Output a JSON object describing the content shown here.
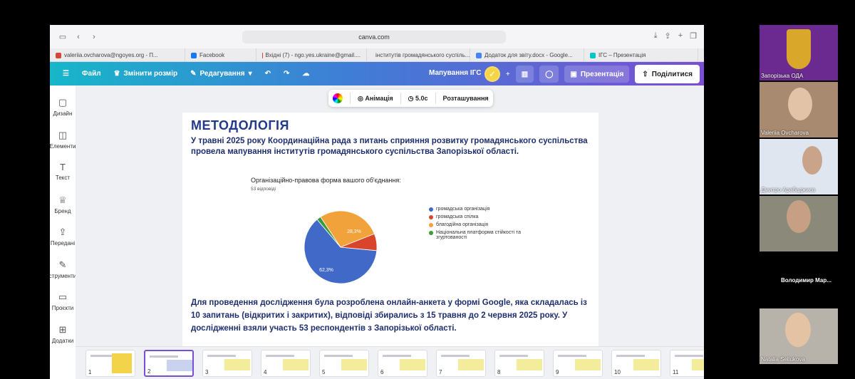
{
  "browser": {
    "url": "canva.com",
    "tabs": [
      {
        "label": "valeriia.ovcharova@ngoyes.org - П...",
        "color": "#d44638"
      },
      {
        "label": "Facebook",
        "color": "#1877f2"
      },
      {
        "label": "Вхідні (7) - ngo.yes.ukraine@gmail....",
        "color": "#d44638"
      },
      {
        "label": "інститутів громадянського суспіль...",
        "color": "#4285f4"
      },
      {
        "label": "Додаток для звіту.docx - Google...",
        "color": "#4285f4"
      },
      {
        "label": "ІГС – Презентація",
        "color": "#00c4cc"
      }
    ]
  },
  "canva": {
    "file_label": "Файл",
    "resize_label": "Змінити розмір",
    "edit_label": "Редагування",
    "doc_title": "Мапування ІГС",
    "present_label": "Презентація",
    "share_label": "Поділитися",
    "sidebar": [
      "Дизайн",
      "Елементи",
      "Текст",
      "Бренд",
      "Передані",
      "струменти",
      "Проєкти",
      "Додатки"
    ],
    "float_bar": {
      "animation": "Анімація",
      "duration": "5.0с",
      "position": "Розташування"
    }
  },
  "slide": {
    "title": "МЕТОДОЛОГІЯ",
    "para1": "У травні 2025 року Координаційна рада з питань сприяння розвитку громадянського суспільства провела мапування інститутів громадянського суспільства Запорізької області.",
    "para2": "Для проведення дослідження була розроблена онлайн-анкета у формі Google, яка складалась із 10 запитань (відкритих і закритих), відповіді збирались з 15 травня до 2 червня 2025 року. У дослідженні взяли участь 53 респондентів з Запорізької області."
  },
  "chart_data": {
    "type": "pie",
    "title": "Організаційно-правова форма вашого об'єднання:",
    "subtitle": "53 відповіді",
    "slices": [
      {
        "label": "громадська організація",
        "value": 62.3,
        "color": "#4169c8"
      },
      {
        "label": "Національна платформа стійкості та згуртованості",
        "value": 1.9,
        "color": "#3c9a3c"
      },
      {
        "label": "благодійна організація",
        "value": 28.3,
        "color": "#f2a23a"
      },
      {
        "label": "громадська спілка",
        "value": 7.5,
        "color": "#d9452b"
      }
    ],
    "data_labels": [
      "62,3%",
      "28,3%"
    ],
    "legend": [
      "громадська організація",
      "громадська спілка",
      "благодійна організація",
      "Національна платформа стійкості та згуртованості"
    ],
    "legend_colors": [
      "#4169c8",
      "#d9452b",
      "#f2a23a",
      "#3c9a3c"
    ]
  },
  "filmstrip": {
    "pages": [
      "1",
      "2",
      "3",
      "4",
      "5",
      "6",
      "7",
      "8",
      "9",
      "10",
      "11"
    ],
    "active": 1
  },
  "participants": [
    "Запорізька ОДА",
    "Valeriia Ovcharova",
    "Дмитро Арабаджиєв",
    "Володимир Мар...",
    "Natalia Seliukova"
  ]
}
